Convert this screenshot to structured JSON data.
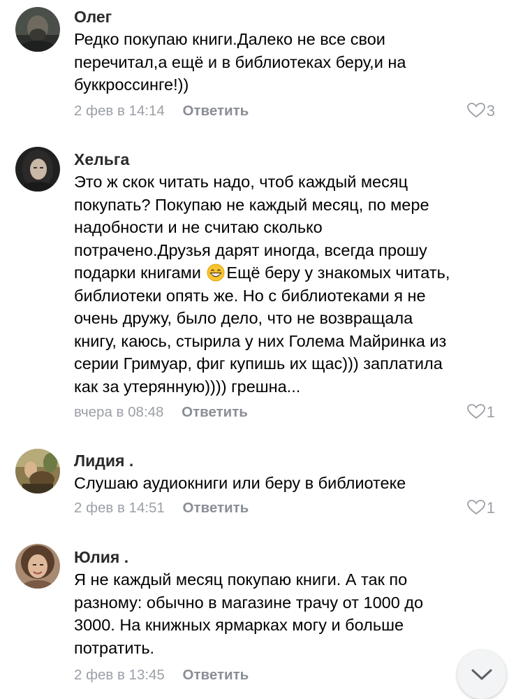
{
  "comments": [
    {
      "author": "Олег",
      "lines": [
        "Редко покупаю книги.Далеко не все свои",
        "перечитал,а ещё и в библиотеках беру,и на",
        "буккроссинге!))"
      ],
      "date": "2 фев в 14:14",
      "reply_label": "Ответить",
      "likes": "3"
    },
    {
      "author": "Хельга",
      "lines": [
        "Это ж скок читать надо, чтоб каждый месяц",
        "покупать?  Покупаю не каждый месяц, по мере",
        "надобности и не считаю сколько",
        "потрачено.Друзья дарят иногда, всегда прошу"
      ],
      "line5_before": "подарки книгами",
      "line5_emoji": "grinning-face-emoji",
      "line5_after": "Ещё беру у знакомых читать,",
      "lines_rest": [
        "библиотеки опять же. Но с библиотеками я не",
        "очень дружу, было дело, что не возвращала",
        "книгу, каюсь, стырила у них Голема Майринка из",
        "серии Гримуар, фиг купишь их щас))) заплатила",
        "как за утерянную)))) грешна..."
      ],
      "date": "вчера в 08:48",
      "reply_label": "Ответить",
      "likes": "1"
    },
    {
      "author": "Лидия .",
      "lines": [
        "Слушаю аудиокниги или беру в библиотеке"
      ],
      "date": "2 фев в 14:51",
      "reply_label": "Ответить",
      "likes": "1"
    },
    {
      "author": "Юлия .",
      "lines": [
        "Я не каждый месяц покупаю книги. А так по",
        "разному: обычно в магазине трачу от 1000 до",
        "3000. На книжных ярмарках могу и больше",
        "потратить."
      ],
      "date": "2 фев в 13:45",
      "reply_label": "Ответить"
    }
  ],
  "icons": {
    "like": "heart-outline-icon",
    "scroll": "chevron-down-icon"
  },
  "colors": {
    "meta_text": "#9b9fa6",
    "reply_text": "#8a8e95",
    "author_text": "#2a2a2a"
  }
}
